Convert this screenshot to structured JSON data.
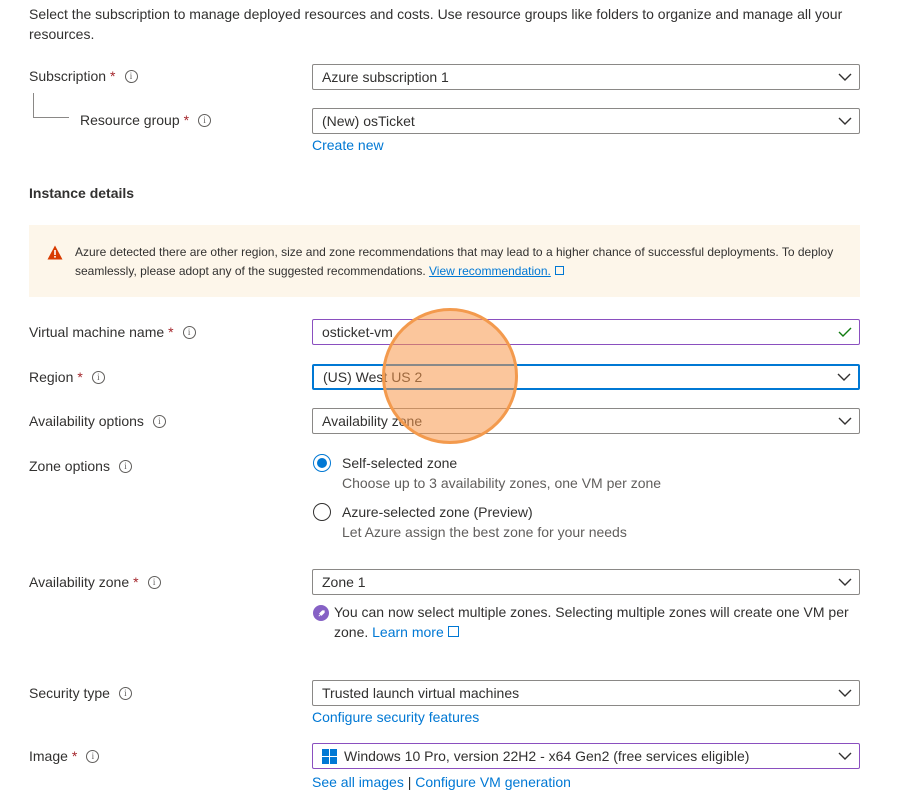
{
  "intro": "Select the subscription to manage deployed resources and costs. Use resource groups like folders to organize and manage all your resources.",
  "project": {
    "subscription": {
      "label": "Subscription",
      "value": "Azure subscription 1"
    },
    "resource_group": {
      "label": "Resource group",
      "value": "(New) osTicket",
      "create_new": "Create new"
    }
  },
  "instance_details": {
    "title": "Instance details",
    "warning": {
      "text": "Azure detected there are other region, size and zone recommendations that may lead to a higher chance of successful deployments. To deploy seamlessly, please adopt any of the suggested recommendations.",
      "link": "View recommendation."
    },
    "vm_name": {
      "label": "Virtual machine name",
      "value": "osticket-vm"
    },
    "region": {
      "label": "Region",
      "value": "(US) West US 2"
    },
    "availability_options": {
      "label": "Availability options",
      "value": "Availability zone"
    },
    "zone_options": {
      "label": "Zone options",
      "options": [
        {
          "label": "Self-selected zone",
          "desc": "Choose up to 3 availability zones, one VM per zone",
          "selected": true
        },
        {
          "label": "Azure-selected zone (Preview)",
          "desc": "Let Azure assign the best zone for your needs",
          "selected": false
        }
      ]
    },
    "availability_zone": {
      "label": "Availability zone",
      "value": "Zone 1",
      "note": "You can now select multiple zones. Selecting multiple zones will create one VM per zone.",
      "learn_more": "Learn more"
    },
    "security_type": {
      "label": "Security type",
      "value": "Trusted launch virtual machines",
      "link": "Configure security features"
    },
    "image": {
      "label": "Image",
      "value": "Windows 10 Pro, version 22H2 - x64 Gen2 (free services eligible)",
      "link_all": "See all images",
      "separator": "|",
      "link_config": "Configure VM generation"
    }
  },
  "icons": {
    "info": "info-icon",
    "chevron": "chevron-down-icon",
    "warning": "warning-icon",
    "check": "checkmark-icon",
    "external": "external-link-icon",
    "rocket": "rocket-icon",
    "windows": "windows-logo-icon"
  },
  "colors": {
    "accent": "#0078d4",
    "required": "#a4262c",
    "warning_bg": "#fdf6ea",
    "focus_purple": "#8a4fbf",
    "cursor": "#f39a4d"
  }
}
